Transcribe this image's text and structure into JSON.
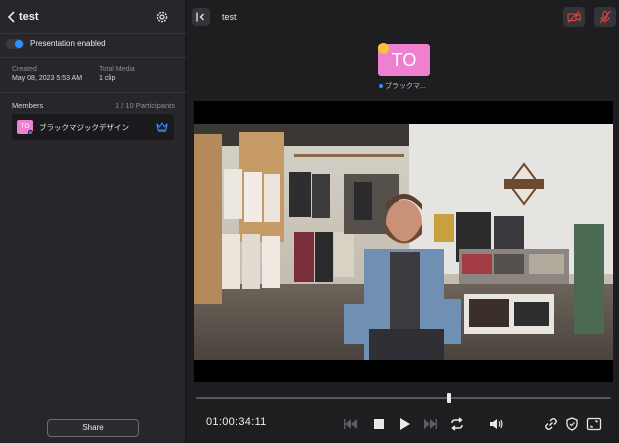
{
  "sidebar": {
    "title": "test",
    "presentation_label": "Presentation enabled",
    "presentation_enabled": true,
    "created_key": "Created",
    "created_value": "May 08, 2023 5:53 AM",
    "media_key": "Total Media",
    "media_value": "1 clip",
    "members_title": "Members",
    "members_count": "1 / 10 Participants",
    "members": [
      {
        "initials": "TO",
        "name": "ブラックマジックデザイン"
      }
    ],
    "share_label": "Share"
  },
  "main": {
    "title": "test",
    "presenter_initials": "TO",
    "presenter_name": "ブラックマ...",
    "timecode": "01:00:34:11",
    "playhead_fraction": 0.61
  },
  "colors": {
    "accent": "#2f8fff",
    "avatar": "#ef7fcf",
    "danger": "#e0463c",
    "crown": "#2f8fff"
  }
}
